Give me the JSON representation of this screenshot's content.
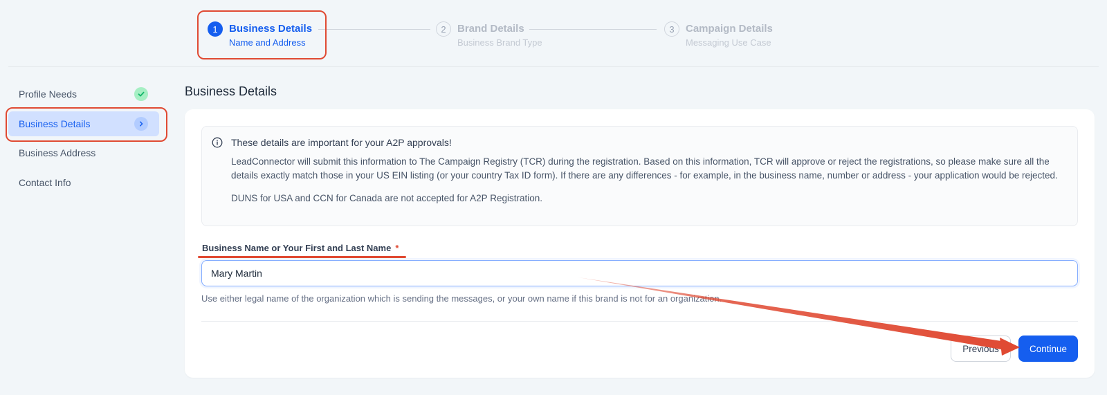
{
  "stepper": {
    "steps": [
      {
        "number": "1",
        "title": "Business Details",
        "subtitle": "Name and Address",
        "state": "active"
      },
      {
        "number": "2",
        "title": "Brand Details",
        "subtitle": "Business Brand Type",
        "state": "inactive"
      },
      {
        "number": "3",
        "title": "Campaign Details",
        "subtitle": "Messaging Use Case",
        "state": "inactive"
      }
    ]
  },
  "sidebar": {
    "items": [
      {
        "label": "Profile Needs",
        "status": "complete",
        "icon": "check-icon"
      },
      {
        "label": "Business Details",
        "status": "current",
        "icon": "chevron-right-icon"
      },
      {
        "label": "Business Address",
        "status": "pending"
      },
      {
        "label": "Contact Info",
        "status": "pending"
      }
    ]
  },
  "main": {
    "title": "Business Details",
    "info": {
      "icon": "info-icon",
      "heading": "These details are important for your A2P approvals!",
      "body": "LeadConnector will submit this information to The Campaign Registry (TCR) during the registration. Based on this information, TCR will approve or reject the registrations, so please make sure all the details exactly match those in your US EIN listing (or your country Tax ID form). If there are any differences - for example, in the business name, number or address - your application would be rejected.",
      "note": "DUNS for USA and CCN for Canada are not accepted for A2P Registration."
    },
    "field": {
      "label": "Business Name or Your First and Last Name",
      "required_marker": "*",
      "value": "Mary Martin",
      "help": "Use either legal name of the organization which is sending the messages, or your own name if this brand is not for an organization."
    },
    "buttons": {
      "previous": "Previous",
      "continue": "Continue"
    }
  },
  "colors": {
    "accent": "#155eef",
    "annotation": "#e04a33",
    "success": "#a6efc4",
    "background": "#f2f6f9"
  }
}
